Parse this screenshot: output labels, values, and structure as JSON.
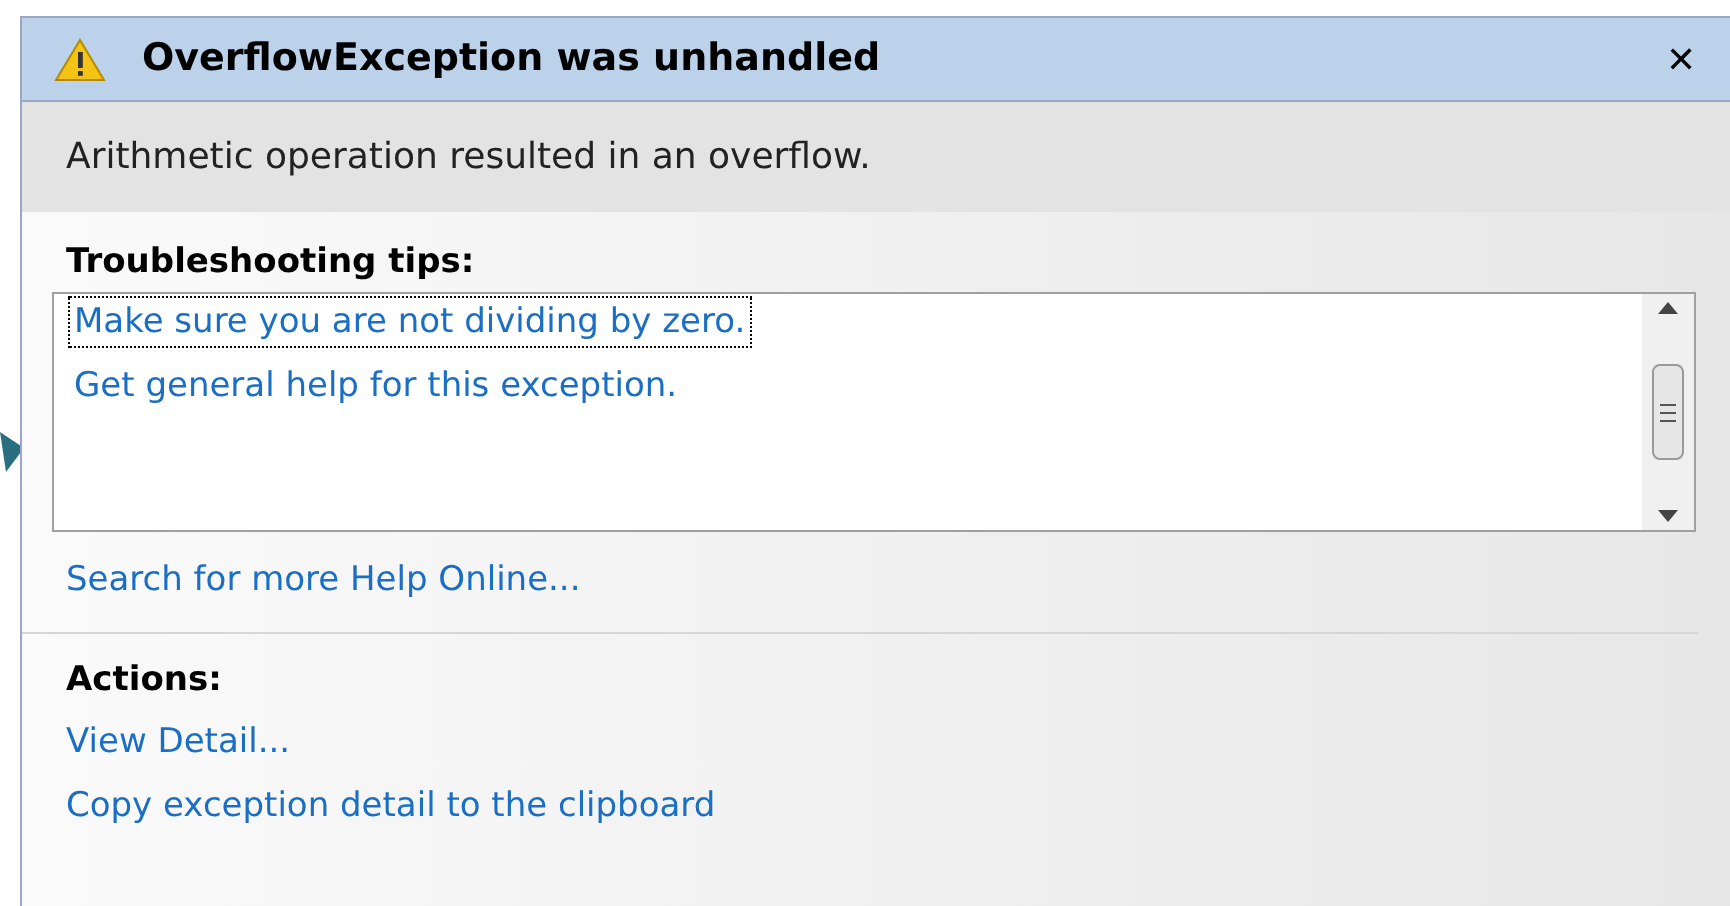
{
  "window": {
    "title": "OverflowException was unhandled",
    "close": "✕"
  },
  "message": "Arithmetic operation resulted in an overflow.",
  "tips": {
    "heading": "Troubleshooting tips:",
    "items": [
      {
        "label": "Make sure you are not dividing by zero.",
        "selected": true
      },
      {
        "label": "Get general help for this exception.",
        "selected": false
      }
    ]
  },
  "search_link": "Search for more Help Online...",
  "actions": {
    "heading": "Actions:",
    "items": [
      "View Detail...",
      "Copy exception detail to the clipboard"
    ]
  }
}
